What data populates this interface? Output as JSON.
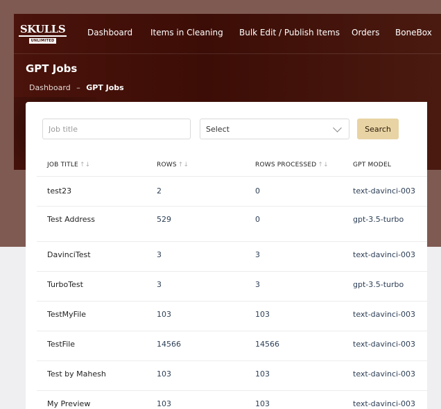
{
  "nav": {
    "logo_main": "SKULLS",
    "logo_sub": "UNLIMITED",
    "links": [
      "Dashboard",
      "Items in Cleaning",
      "Bulk Edit / Publish Items",
      "Orders",
      "BoneBox"
    ]
  },
  "page": {
    "title": "GPT Jobs",
    "breadcrumb": {
      "home": "Dashboard",
      "separator": "–",
      "current": "GPT Jobs"
    }
  },
  "filters": {
    "job_title_placeholder": "Job title",
    "select_value": "Select",
    "search_label": "Search"
  },
  "table": {
    "headers": {
      "job_title": "JOB TITLE",
      "rows": "ROWS",
      "rows_processed": "ROWS PROCESSED",
      "gpt_model": "GPT MODEL"
    },
    "sort_icon": "↑↓",
    "rows": [
      {
        "title": "test23",
        "rows": "2",
        "processed": "0",
        "model": "text-davinci-003"
      },
      {
        "title": "Test Address",
        "rows": "529",
        "processed": "0",
        "model": "gpt-3.5-turbo"
      },
      {
        "title": "DavinciTest",
        "rows": "3",
        "processed": "3",
        "model": "text-davinci-003"
      },
      {
        "title": "TurboTest",
        "rows": "3",
        "processed": "3",
        "model": "gpt-3.5-turbo"
      },
      {
        "title": "TestMyFile",
        "rows": "103",
        "processed": "103",
        "model": "text-davinci-003"
      },
      {
        "title": "TestFile",
        "rows": "14566",
        "processed": "14566",
        "model": "text-davinci-003"
      },
      {
        "title": "Test by Mahesh",
        "rows": "103",
        "processed": "103",
        "model": "text-davinci-003"
      },
      {
        "title": "My Preview",
        "rows": "103",
        "processed": "103",
        "model": "text-davinci-003"
      }
    ]
  },
  "colors": {
    "hero": "#3c0d06",
    "backdrop": "#7f5a52",
    "search_button": "#e8d3a4"
  }
}
